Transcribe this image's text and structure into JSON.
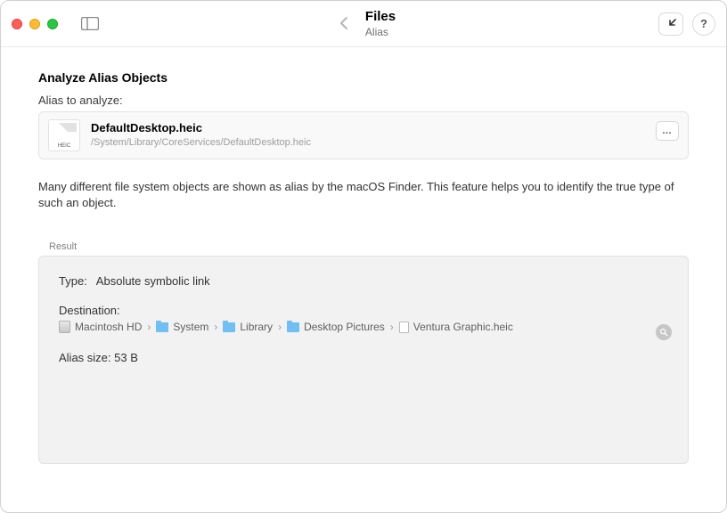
{
  "window": {
    "title": "Files",
    "subtitle": "Alias"
  },
  "section": {
    "header": "Analyze Alias Objects",
    "alias_label": "Alias to analyze:",
    "description": "Many different file system objects are shown as alias by the macOS Finder. This feature helps you to identify the true type of such an object."
  },
  "selected_file": {
    "name": "DefaultDesktop.heic",
    "path": "/System/Library/CoreServices/DefaultDesktop.heic",
    "thumb_label": "HEIC"
  },
  "more_button_label": "…",
  "result": {
    "group_label": "Result",
    "type_label": "Type:",
    "type_value": "Absolute symbolic link",
    "destination_label": "Destination:",
    "breadcrumb": [
      "Macintosh HD",
      "System",
      "Library",
      "Desktop Pictures",
      "Ventura Graphic.heic"
    ],
    "alias_size_label": "Alias size:",
    "alias_size_value": "53  B"
  }
}
